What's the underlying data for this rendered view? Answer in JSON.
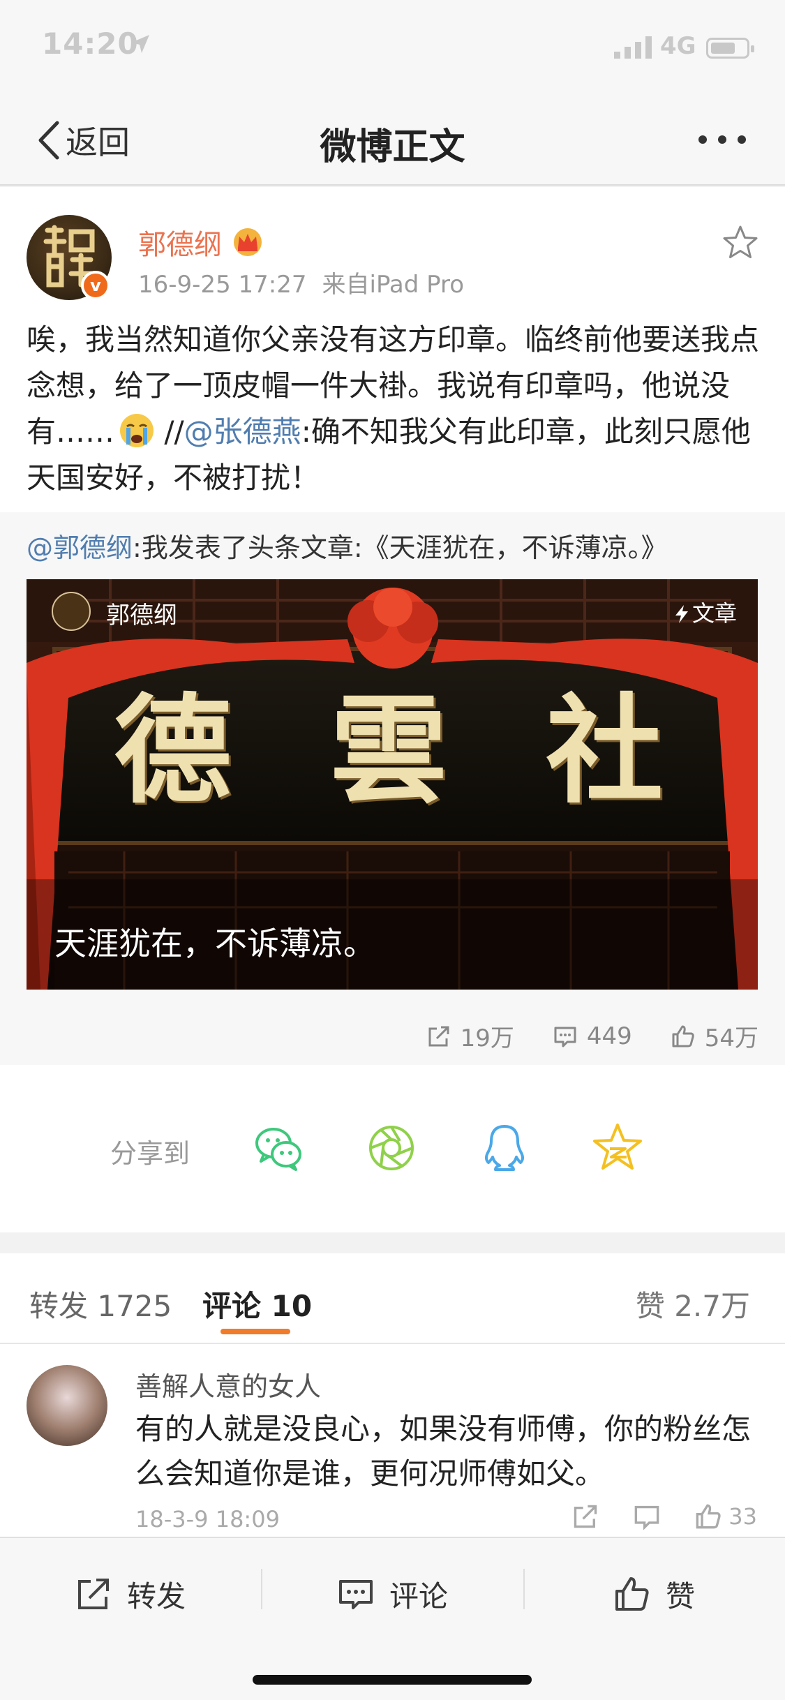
{
  "status_bar": {
    "time": "14:20",
    "network": "4G"
  },
  "nav": {
    "back_label": "返回",
    "title": "微博正文"
  },
  "post": {
    "author": "郭德纲",
    "date": "16-9-25 17:27",
    "source": "来自iPad Pro",
    "text_part1": "唉，我当然知道你父亲没有这方印章。临终前他要送我点念想，给了一顶皮帽一件大褂。我说有印章吗，他说没有……",
    "text_sep": " //",
    "text_mention": "@张德燕",
    "text_part2": ":确不知我父有此印章，此刻只愿他天国安好，不被打扰！",
    "repost_mention": "@郭德纲",
    "repost_text": ":我发表了头条文章:《天涯犹在，不诉薄凉。》",
    "card": {
      "author": "郭德纲",
      "tag": "文章",
      "title": "天涯犹在，不诉薄凉。",
      "plaque": [
        "德",
        "雲",
        "社"
      ]
    },
    "actions": {
      "reposts": "19万",
      "comments": "449",
      "likes": "54万"
    }
  },
  "share": {
    "label": "分享到",
    "targets": [
      "wechat-icon",
      "moments-icon",
      "qq-icon",
      "qzone-icon"
    ],
    "colors": {
      "wechat": "#3ec87c",
      "moments": "#8fd14a",
      "qq": "#4aa8e8",
      "qzone": "#f4c021"
    }
  },
  "tabs": {
    "repost": "转发 1725",
    "comment": "评论 10",
    "like": "赞 2.7万",
    "accent": "#f07b2a"
  },
  "comment": {
    "user": "善解人意的女人",
    "text": "有的人就是没良心，如果没有师傅，你的粉丝怎么会知道你是谁，更何况师傅如父。",
    "time": "18-3-9 18:09",
    "likes": "33"
  },
  "toolbar": {
    "repost": "转发",
    "comment": "评论",
    "like": "赞"
  },
  "colors": {
    "link": "#507daf",
    "author": "#eb7350"
  }
}
